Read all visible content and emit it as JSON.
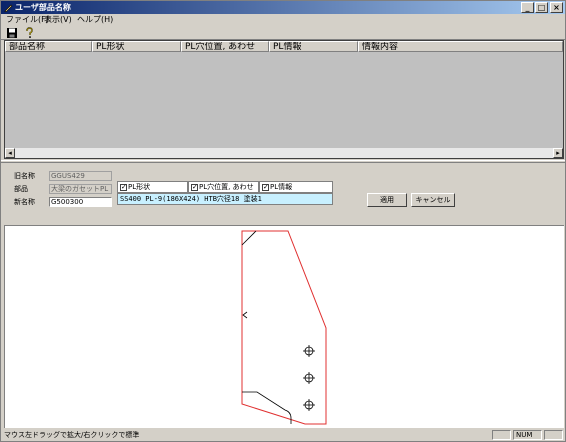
{
  "window": {
    "title": "ユーザ部品名称",
    "minimize": "_",
    "maximize": "□",
    "close": "×"
  },
  "menu": [
    "ファイル(F)",
    "表示(V)",
    "ヘルプ(H)"
  ],
  "toolbar": {
    "save_icon": "save-icon",
    "help_icon": "help-pointer-icon"
  },
  "list": {
    "columns": [
      "部品名称",
      "PL形状",
      "PL穴位置, あわせ",
      "PL情報",
      "情報内容"
    ]
  },
  "form": {
    "old_name_label": "旧名称",
    "old_name_value": "GGUS429",
    "part_label": "部品",
    "part_value": "大梁のガセットPL",
    "new_name_label": "新名称",
    "new_name_value": "G500300",
    "check_pl_shape": "PL形状",
    "check_pl_hole": "PL穴位置, あわせ",
    "check_pl_info": "PL情報",
    "info_line": "SS400  PL-9(186X424)  HTB穴径18  塗装1",
    "apply_button": "適用",
    "cancel_button": "キャンセル"
  },
  "status": {
    "message": "マウス左ドラッグで拡大/右クリックで標準",
    "num": "NUM"
  },
  "colors": {
    "titlebar_start": "#0a246a",
    "titlebar_end": "#a6caf0",
    "outline_red": "#e03030",
    "info_bg": "#c8f0ff"
  }
}
